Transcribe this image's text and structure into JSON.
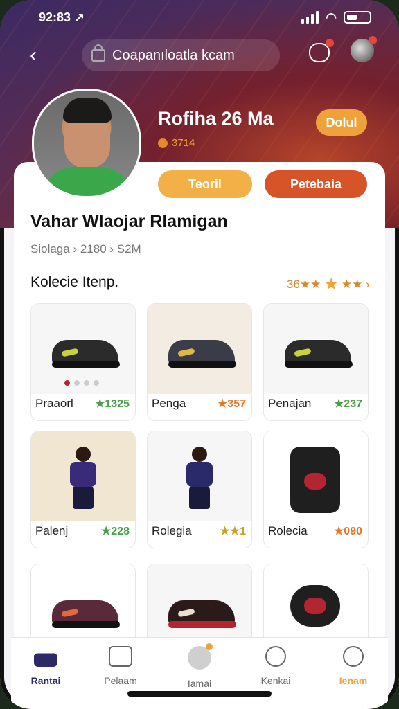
{
  "status": {
    "time": "92:83 ↗"
  },
  "topbar": {
    "search_text": "Coapanıloatla kcam"
  },
  "profile": {
    "name": "Rofiha 26 Ma",
    "coins": "3714",
    "top_button": "Dolul"
  },
  "actions": {
    "primary": "Teoril",
    "secondary": "Petebaia"
  },
  "page": {
    "title": "Vahar Wlaojar Rlamigan",
    "breadcrumb": [
      "Siolaga",
      "2180",
      "S2M"
    ]
  },
  "section": {
    "title": "Kolecie Itenp.",
    "rating_text": "36★★",
    "rating_tail": "★★ ›"
  },
  "items": [
    {
      "label": "Praaorl",
      "price": "★1325"
    },
    {
      "label": "Penga",
      "price": "★357"
    },
    {
      "label": "Penajan",
      "price": "★237"
    },
    {
      "label": "Palenj",
      "price": "★228"
    },
    {
      "label": "Rolegia",
      "price": "★★1"
    },
    {
      "label": "Rolecia",
      "price": "★090"
    },
    {
      "label": "",
      "price": ""
    },
    {
      "label": "",
      "price": ""
    },
    {
      "label": "",
      "price": ""
    }
  ],
  "nav": [
    {
      "label": "Rantai"
    },
    {
      "label": "Pelaam"
    },
    {
      "label": "Iamai"
    },
    {
      "label": "Kenkai"
    },
    {
      "label": "Ienam"
    }
  ],
  "colors": {
    "accent": "#f0a23a",
    "secondary": "#d75328",
    "price_green": "#48a048"
  }
}
